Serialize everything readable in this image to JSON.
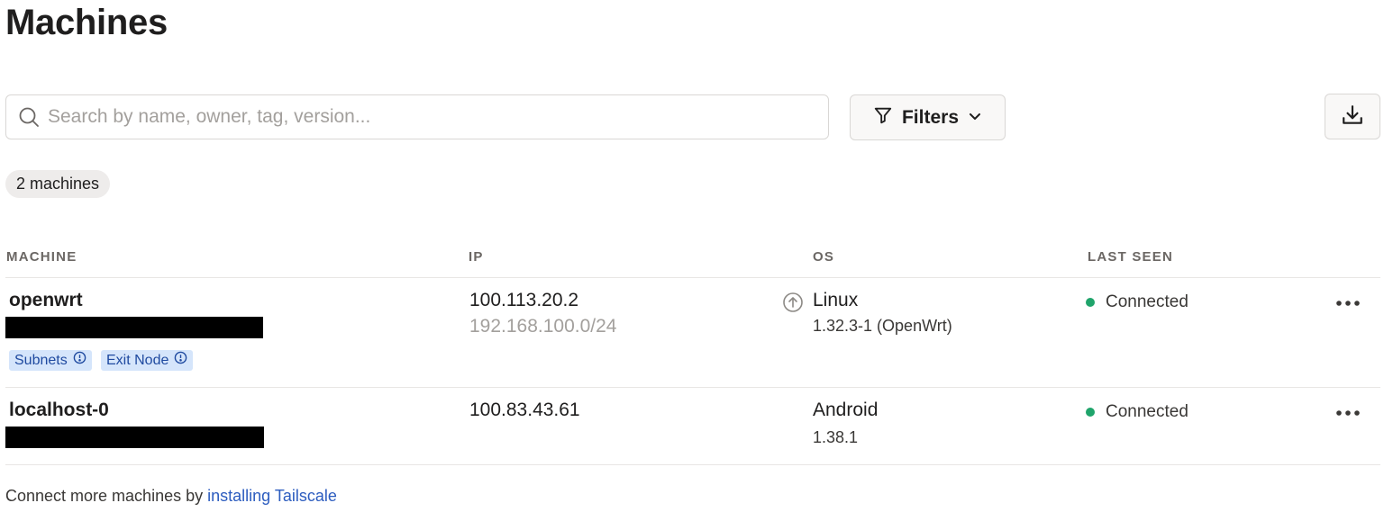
{
  "page": {
    "title": "Machines"
  },
  "toolbar": {
    "search_placeholder": "Search by name, owner, tag, version...",
    "search_value": "",
    "filters_label": "Filters",
    "icons": {
      "search": "search-icon",
      "filter": "filter-icon",
      "chevron": "chevron-down-icon",
      "download": "download-icon"
    }
  },
  "summary": {
    "count_label": "2 machines"
  },
  "table": {
    "columns": {
      "machine": "MACHINE",
      "ip": "IP",
      "os": "OS",
      "last_seen": "LAST SEEN"
    },
    "rows": [
      {
        "name": "openwrt",
        "tags": [
          "Subnets",
          "Exit Node"
        ],
        "ip_primary": "100.113.20.2",
        "ip_secondary": "192.168.100.0/24",
        "os_name": "Linux",
        "os_version": "1.32.3-1 (OpenWrt)",
        "update_available": true,
        "status": "Connected",
        "status_color": "#1fa46b"
      },
      {
        "name": "localhost-0",
        "tags": [],
        "ip_primary": "100.83.43.61",
        "ip_secondary": "",
        "os_name": "Android",
        "os_version": "1.38.1",
        "update_available": false,
        "status": "Connected",
        "status_color": "#1fa46b"
      }
    ]
  },
  "footer": {
    "prefix": "Connect more machines by ",
    "link_text": "installing Tailscale"
  },
  "colors": {
    "tag_background": "#d5e5fb",
    "tag_text": "#1f4aa0",
    "link": "#2c5cbf",
    "status_connected": "#1fa46b"
  }
}
